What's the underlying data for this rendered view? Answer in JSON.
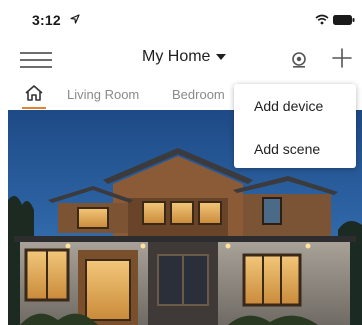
{
  "status_bar": {
    "time": "3:12"
  },
  "app_bar": {
    "home_title": "My Home"
  },
  "tabs": [
    {
      "label": "Living Room"
    },
    {
      "label": "Bedroom"
    }
  ],
  "add_menu": {
    "items": [
      {
        "label": "Add device"
      },
      {
        "label": "Add scene"
      }
    ]
  }
}
